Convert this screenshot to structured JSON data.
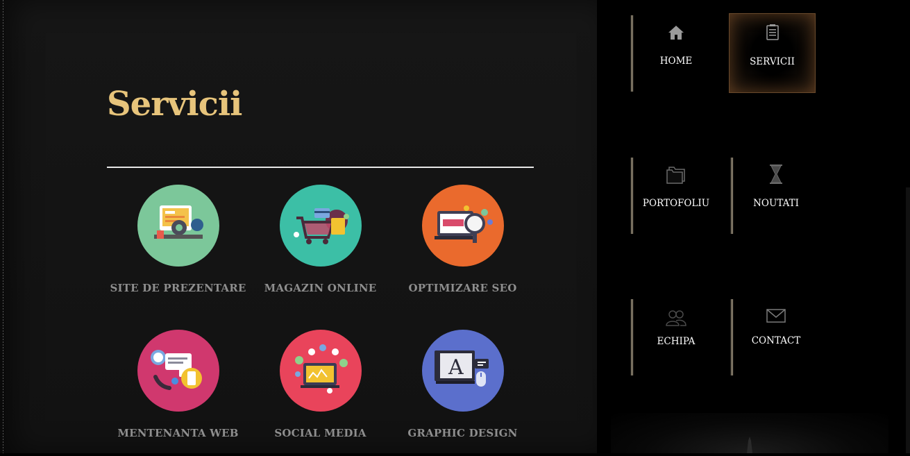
{
  "page": {
    "title": "Servicii"
  },
  "services": [
    {
      "label": "SITE DE PREZENTARE",
      "icon": "website-presentation-icon",
      "color": "#7cc79a"
    },
    {
      "label": "MAGAZIN ONLINE",
      "icon": "shopping-cart-icon",
      "color": "#3cbfa6"
    },
    {
      "label": "OPTIMIZARE SEO",
      "icon": "seo-magnifier-icon",
      "color": "#ea6a2d"
    },
    {
      "label": "MENTENANTA WEB",
      "icon": "support-24-icon",
      "color": "#d0386e"
    },
    {
      "label": "SOCIAL MEDIA",
      "icon": "social-media-icon",
      "color": "#e9445b"
    },
    {
      "label": "GRAPHIC DESIGN",
      "icon": "graphic-design-icon",
      "color": "#5b6fcc"
    }
  ],
  "nav": {
    "items": [
      {
        "label": "HOME",
        "icon": "home-icon",
        "active": false
      },
      {
        "label": "SERVICII",
        "icon": "list-icon",
        "active": true
      },
      {
        "label": "PORTOFOLIU",
        "icon": "folder-icon",
        "active": false
      },
      {
        "label": "NOUTATI",
        "icon": "hourglass-icon",
        "active": false
      },
      {
        "label": "ECHIPA",
        "icon": "team-icon",
        "active": false
      },
      {
        "label": "CONTACT",
        "icon": "envelope-icon",
        "active": false
      }
    ]
  },
  "colors": {
    "title": "#e7c47b",
    "active_border": "#6a4a2c",
    "label": "#8e8e8e"
  }
}
